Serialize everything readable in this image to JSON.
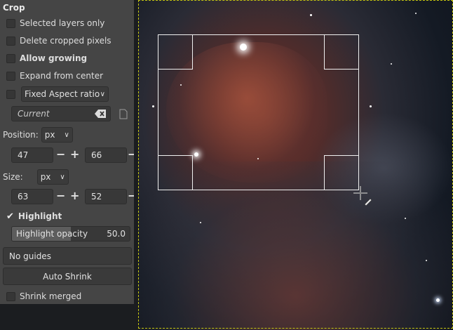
{
  "panel": {
    "title": "Crop",
    "selected_layers_only": {
      "label": "Selected layers only",
      "checked": false
    },
    "delete_cropped_pixels": {
      "label": "Delete cropped pixels",
      "checked": false
    },
    "allow_growing": {
      "label": "Allow growing",
      "checked": false
    },
    "expand_from_center": {
      "label": "Expand from center",
      "checked": false
    },
    "fixed_aspect": {
      "checked": false,
      "mode": "Fixed Aspect ratio"
    },
    "current_value": "Current",
    "position": {
      "label": "Position:",
      "unit": "px",
      "x": "47",
      "y": "66"
    },
    "size": {
      "label": "Size:",
      "unit": "px",
      "w": "63",
      "h": "52"
    },
    "highlight": {
      "label": "Highlight",
      "checked": true
    },
    "highlight_opacity": {
      "label": "Highlight opacity",
      "value": "50.0",
      "fraction": 0.5
    },
    "guides": "No guides",
    "auto_shrink": "Auto Shrink",
    "shrink_merged": {
      "label": "Shrink merged",
      "checked": false
    }
  },
  "icons": {
    "clear": "backspace-clear-icon",
    "document": "document-icon",
    "check": "✔",
    "chevron": "❯"
  }
}
